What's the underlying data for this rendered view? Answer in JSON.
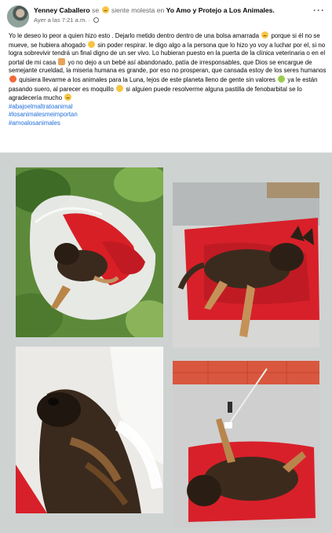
{
  "post": {
    "author": "Yenney Caballero",
    "se_text": "se",
    "feeling_text": "siente molesta en",
    "group": "Yo Amo y Protejo a Los Animales.",
    "timestamp": "Ayer a las 7:21 a.m. ·",
    "more_label": "···",
    "text_1": "Yo le deseo lo peor a quien hizo esto . Dejarlo metido dentro dentro de una bolsa amarrada",
    "text_2": "porque si él no se mueve, se hubiera ahogado",
    "text_3": "sin poder respirar.  le digo algo a la persona que lo hizo yo voy a luchar por el, si no logra sobrevivir tendrá un final digno de un ser vivo. Lo hubieran puesto en la puerta de la clínica veterinaria o en el portal de mi casa",
    "text_4": "yo no dejo a un bebé así abandonado, patía de irresponsables, que Dios se encargue de semejante crueldad, la miseria humana es grande, por eso no prosperan, que cansada estoy de los seres humanos",
    "text_5": "quisiera llevarme a los animales para la Luna, lejos de este planeta lleno de gente sin valores",
    "text_6": "ya le están pasando suero, al parecer es moquillo",
    "text_7": "si alguien puede resolverme alguna pastilla de fenobarbital se lo agradecería mucho",
    "hashtags": [
      "#abajoelmaltratoanimal",
      "#losanimalesmeimportan",
      "#amoalosanimales"
    ],
    "icons": {
      "feeling": "sad-emoji-icon",
      "privacy": "globe-icon",
      "more": "more-dots-icon"
    },
    "colors": {
      "link": "#216fdb",
      "secondary_text": "#65676b",
      "grid_background": "#ced3d2",
      "towel_red": "#d8202a"
    }
  }
}
